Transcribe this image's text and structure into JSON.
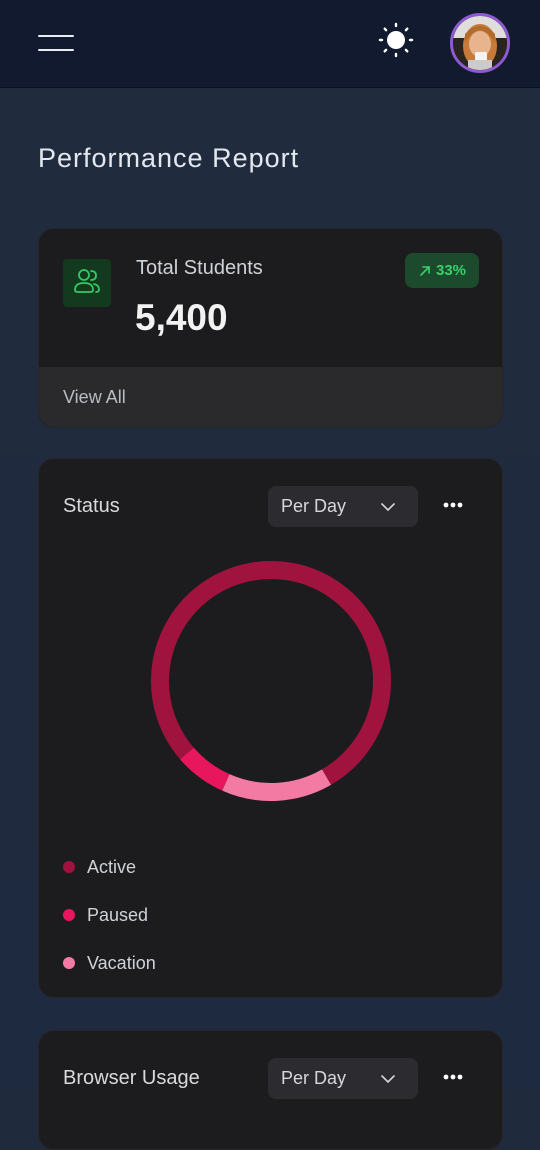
{
  "header": {
    "menu_icon": "hamburger-menu-icon",
    "theme_icon": "sun-icon",
    "avatar_icon": "user-avatar"
  },
  "page": {
    "title": "Performance Report"
  },
  "students_card": {
    "icon": "users-icon",
    "label": "Total Students",
    "value": "5,400",
    "trend": "33%",
    "trend_icon": "arrow-up-right-icon",
    "footer_link": "View All",
    "colors": {
      "accent": "#3ccf6c",
      "badge_bg": "#1b4a2c",
      "icon_bg": "#133a1f"
    }
  },
  "status_card": {
    "title": "Status",
    "period": "Per Day",
    "more_icon": "more-horizontal-icon",
    "legend": [
      {
        "label": "Active",
        "color": "#a0133f",
        "value": 78
      },
      {
        "label": "Paused",
        "color": "#e8175d",
        "value": 7
      },
      {
        "label": "Vacation",
        "color": "#f27aa3",
        "value": 15
      }
    ]
  },
  "browser_card": {
    "title": "Browser Usage",
    "period": "Per Day",
    "more_icon": "more-horizontal-icon"
  }
}
